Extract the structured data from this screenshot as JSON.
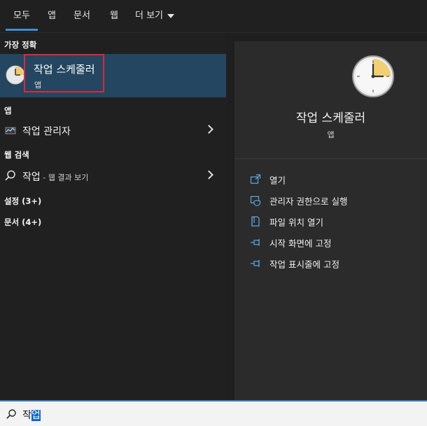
{
  "tabs": [
    {
      "label": "모두"
    },
    {
      "label": "앱"
    },
    {
      "label": "문서"
    },
    {
      "label": "웹"
    },
    {
      "label": "더 보기"
    }
  ],
  "best_match": {
    "heading": "가장 정확",
    "title": "작업 스케줄러",
    "subtitle": "앱"
  },
  "apps": {
    "heading": "앱",
    "items": [
      {
        "label": "작업 관리자",
        "icon": "task-manager-icon"
      }
    ]
  },
  "web": {
    "heading": "웹 검색",
    "query": "작업",
    "suffix": " - 웹 결과 보기"
  },
  "settings_label": "설정 (3+)",
  "documents_label": "문서 (4+)",
  "preview": {
    "title": "작업 스케줄러",
    "type": "앱",
    "actions": [
      {
        "label": "열기",
        "icon": "open-icon"
      },
      {
        "label": "관리자 권한으로 실행",
        "icon": "admin-shield-icon"
      },
      {
        "label": "파일 위치 열기",
        "icon": "file-location-icon"
      },
      {
        "label": "시작 화면에 고정",
        "icon": "pin-start-icon"
      },
      {
        "label": "작업 표시줄에 고정",
        "icon": "pin-taskbar-icon"
      }
    ]
  },
  "search": {
    "typed": "작",
    "selected": "업"
  },
  "colors": {
    "accent": "#3b8fd8",
    "highlight_row": "#244660",
    "red_outline": "#e0263a",
    "selection": "#0b67d1"
  }
}
